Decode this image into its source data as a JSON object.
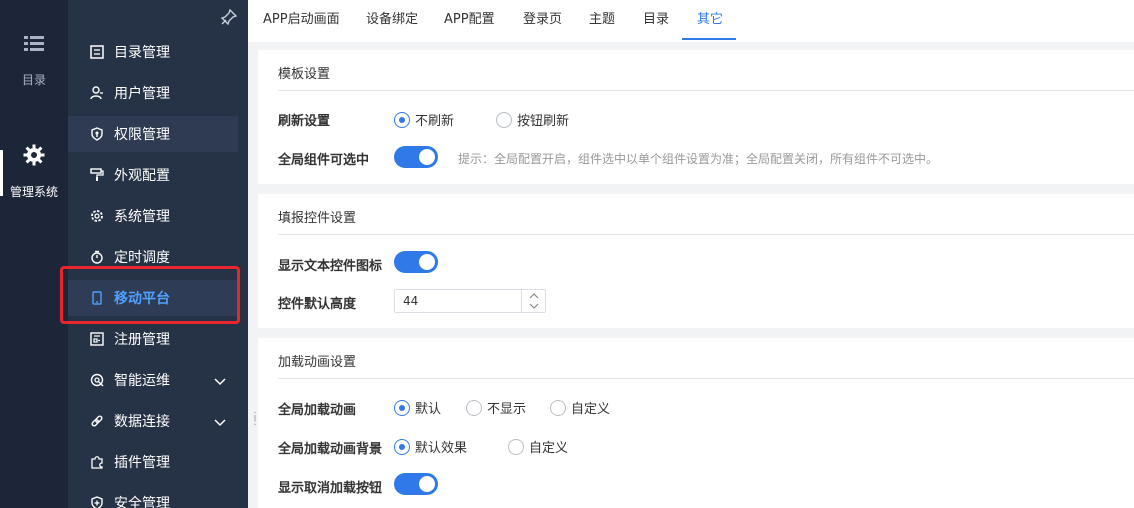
{
  "rail": {
    "menu_label": "目录",
    "system_label": "管理系统"
  },
  "sidebar": {
    "items": [
      {
        "label": "目录管理",
        "icon": "catalog-icon"
      },
      {
        "label": "用户管理",
        "icon": "user-icon"
      },
      {
        "label": "权限管理",
        "icon": "permission-icon"
      },
      {
        "label": "外观配置",
        "icon": "paint-roller-icon"
      },
      {
        "label": "系统管理",
        "icon": "gear-icon"
      },
      {
        "label": "定时调度",
        "icon": "stopwatch-icon"
      },
      {
        "label": "移动平台",
        "icon": "mobile-icon"
      },
      {
        "label": "注册管理",
        "icon": "register-icon"
      },
      {
        "label": "智能运维",
        "icon": "ops-icon"
      },
      {
        "label": "数据连接",
        "icon": "link-icon"
      },
      {
        "label": "插件管理",
        "icon": "plugin-icon"
      },
      {
        "label": "安全管理",
        "icon": "shield-icon"
      }
    ]
  },
  "tabs": [
    "APP启动画面",
    "设备绑定",
    "APP配置",
    "登录页",
    "主题",
    "目录",
    "其它"
  ],
  "template_card": {
    "title": "模板设置",
    "refresh_label": "刷新设置",
    "refresh_options": [
      "不刷新",
      "按钮刷新"
    ],
    "global_select_label": "全局组件可选中",
    "global_select_hint": "提示：全局配置开启，组件选中以单个组件设置为准；全局配置关闭，所有组件不可选中。"
  },
  "fill_card": {
    "title": "填报控件设置",
    "show_icon_label": "显示文本控件图标",
    "default_height_label": "控件默认高度",
    "default_height_value": "44"
  },
  "loading_card": {
    "title": "加载动画设置",
    "global_anim_label": "全局加载动画",
    "global_anim_options": [
      "默认",
      "不显示",
      "自定义"
    ],
    "anim_bg_label": "全局加载动画背景",
    "anim_bg_options": [
      "默认效果",
      "自定义"
    ],
    "show_cancel_label": "显示取消加载按钮"
  },
  "colors": {
    "accent": "#2f7ae8",
    "sidebar_bg": "#263246",
    "rail_bg": "#1c2638",
    "highlight": "#e8262b"
  }
}
